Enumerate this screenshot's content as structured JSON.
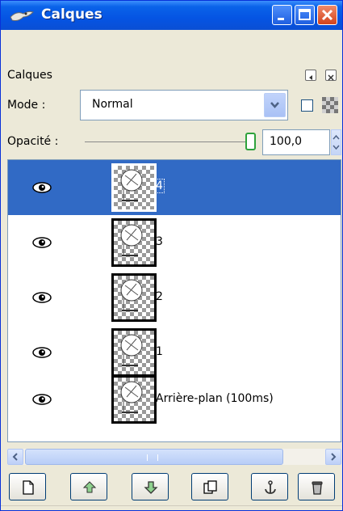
{
  "window": {
    "title": "Calques"
  },
  "dock": {
    "title": "Calques"
  },
  "mode": {
    "label": "Mode :",
    "value": "Normal"
  },
  "opacity": {
    "label": "Opacité :",
    "value": "100,0",
    "level_percent": 100
  },
  "layers": [
    {
      "name": "4",
      "visible": true,
      "selected": true
    },
    {
      "name": "3",
      "visible": true,
      "selected": false
    },
    {
      "name": "2",
      "visible": true,
      "selected": false
    },
    {
      "name": "1",
      "visible": true,
      "selected": false
    },
    {
      "name": "Arrière-plan (100ms)",
      "visible": true,
      "selected": false
    }
  ],
  "toolbar": {
    "buttons": [
      "new-layer-icon",
      "raise-layer-icon",
      "lower-layer-icon",
      "duplicate-layer-icon",
      "anchor-icon",
      "delete-layer-icon"
    ]
  },
  "colors": {
    "titlebar": "#0554e3",
    "selection": "#316ac5",
    "window_bg": "#ece9d8"
  }
}
